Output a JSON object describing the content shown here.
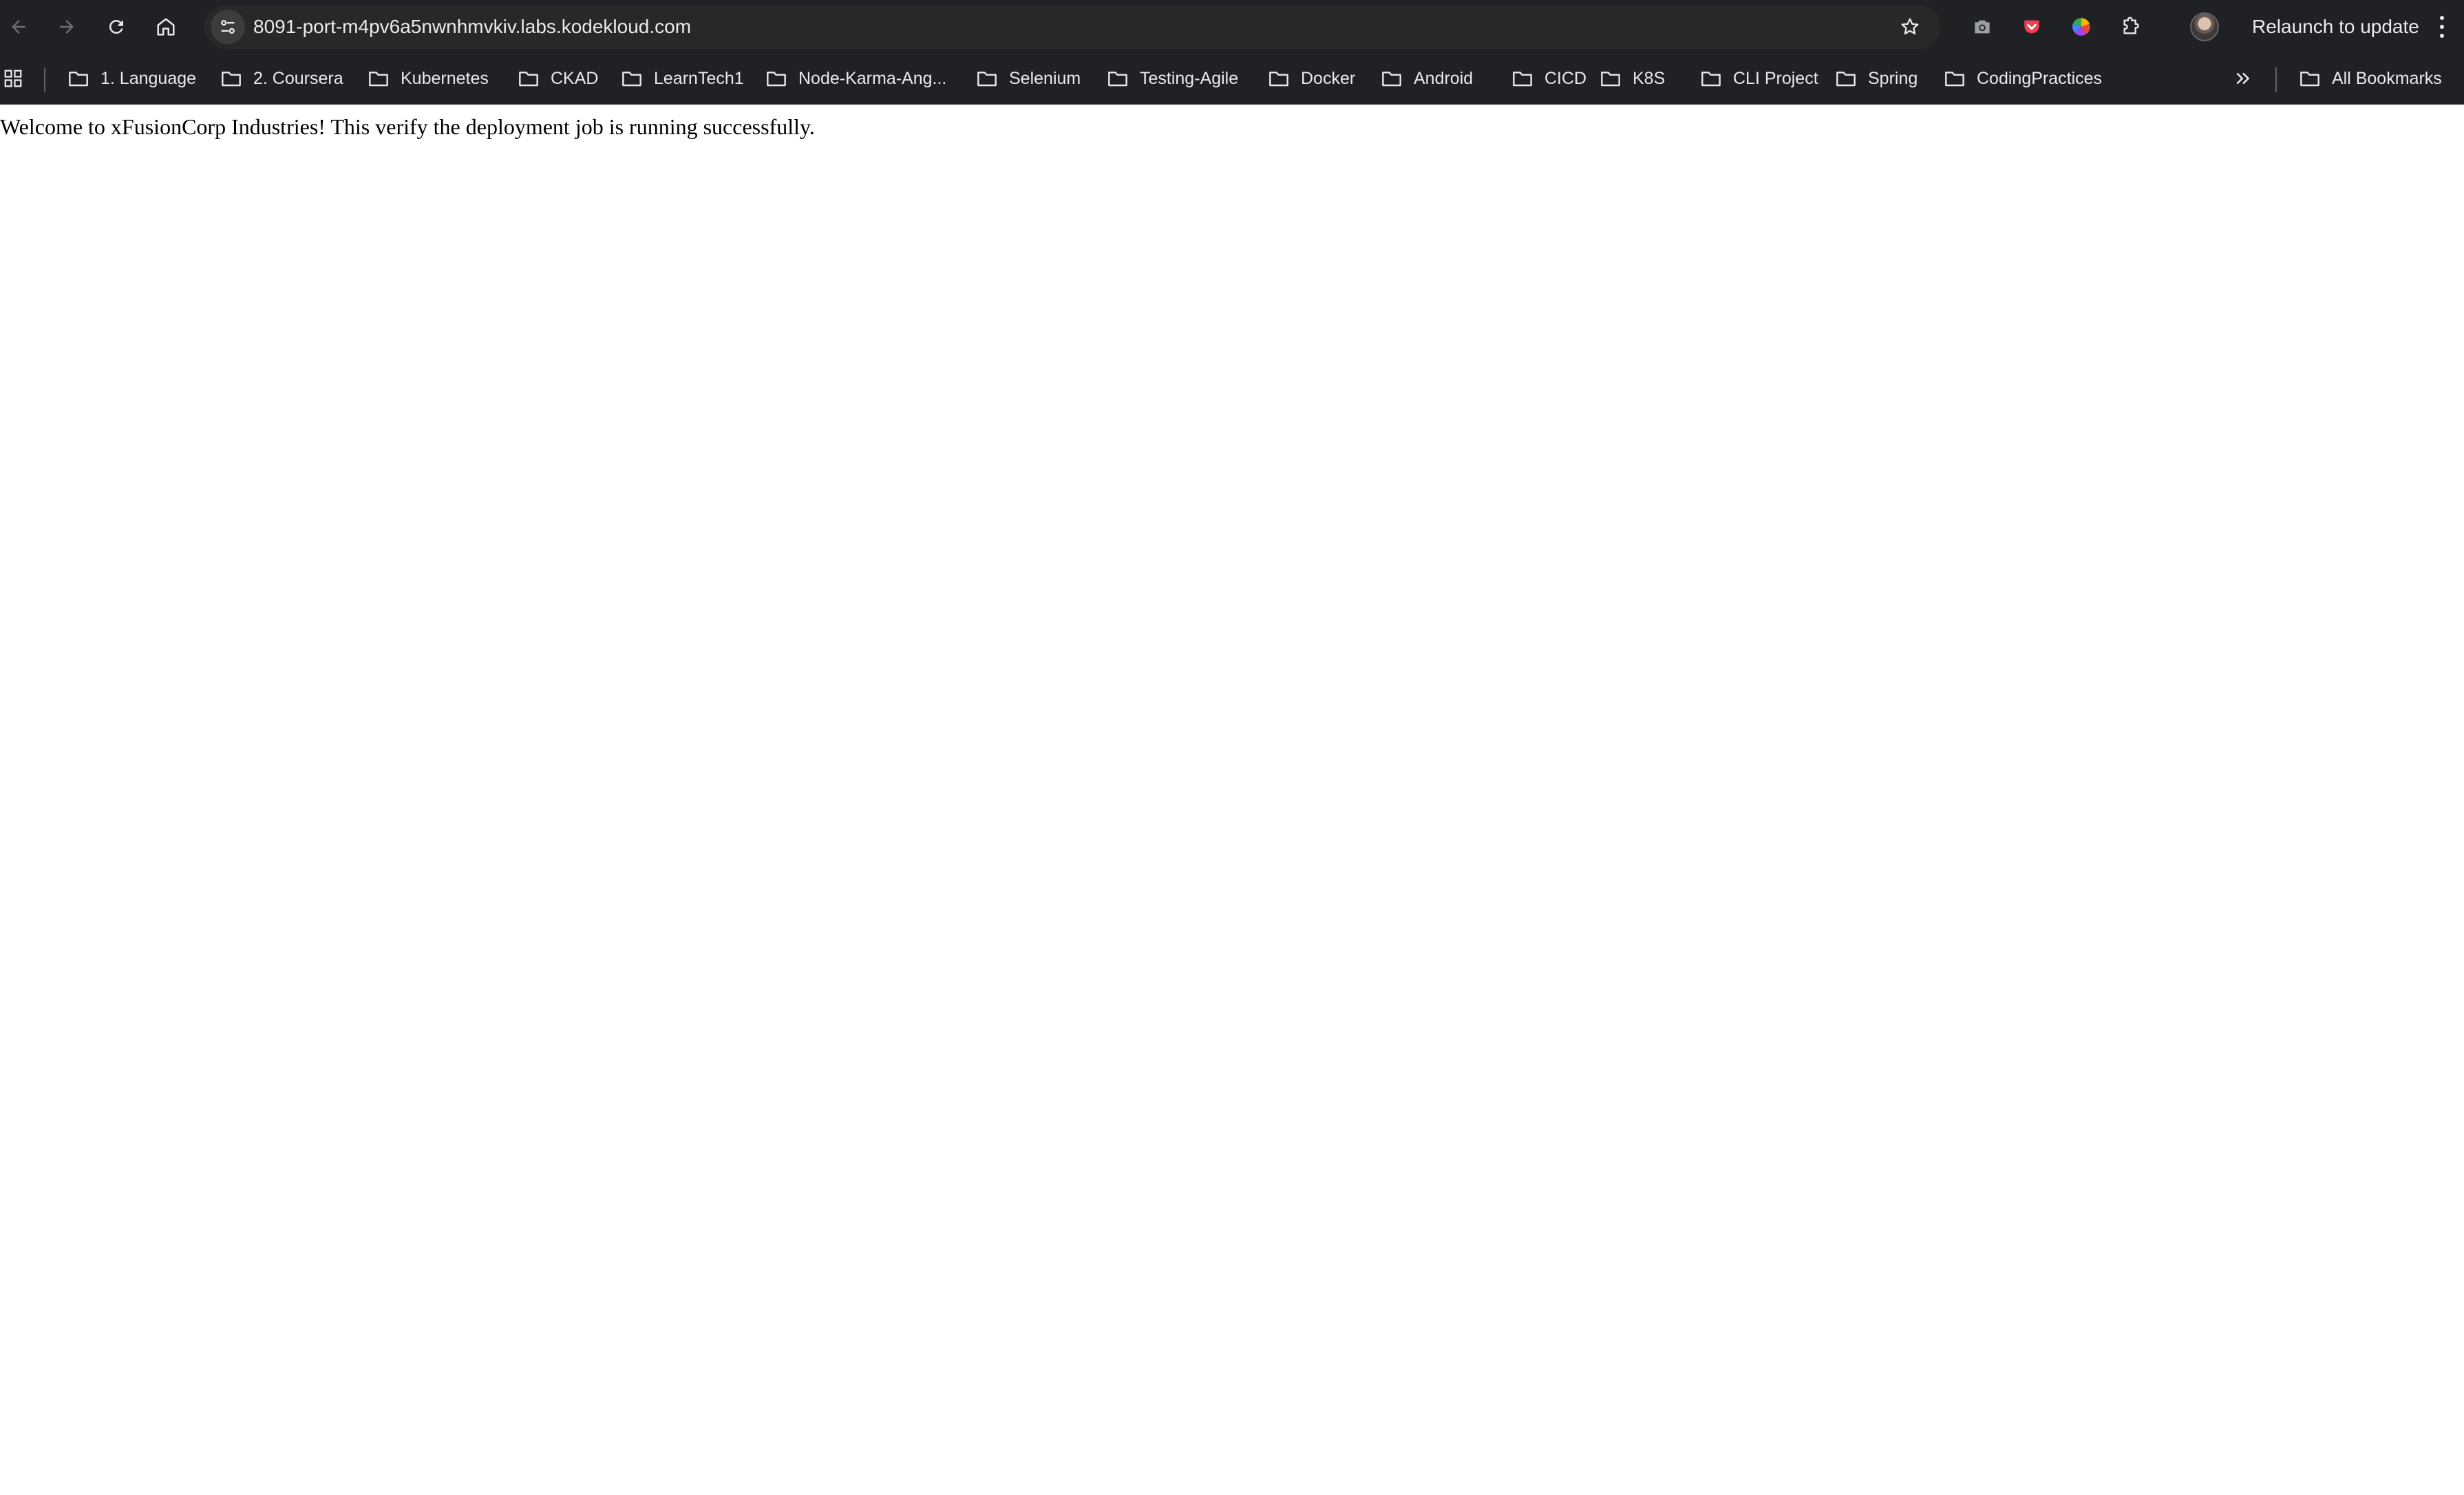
{
  "browser": {
    "url": "8091-port-m4pv6a5nwnhmvkiv.labs.kodekloud.com",
    "relaunch_label": "Relaunch to update",
    "toolbar_icons": [
      "back-icon",
      "forward-icon",
      "reload-icon",
      "home-icon",
      "site-info-icon",
      "bookmark-star-icon",
      "camera-icon",
      "pocket-icon",
      "color-picker-icon",
      "extensions-icon",
      "avatar",
      "menu-icon"
    ]
  },
  "bookmarks": {
    "items": [
      {
        "label": "1. Language"
      },
      {
        "label": "2. Coursera"
      },
      {
        "label": "Kubernetes"
      },
      {
        "label": "CKAD"
      },
      {
        "label": "LearnTech1"
      },
      {
        "label": "Node-Karma-Ang..."
      },
      {
        "label": "Selenium"
      },
      {
        "label": "Testing-Agile"
      },
      {
        "label": "Docker"
      },
      {
        "label": "Android"
      },
      {
        "label": "CICD"
      },
      {
        "label": "K8S"
      },
      {
        "label": "CLI Project"
      },
      {
        "label": "Spring"
      },
      {
        "label": "CodingPractices"
      }
    ],
    "all_bookmarks_label": "All Bookmarks"
  },
  "page": {
    "message": "Welcome to xFusionCorp Industries! This verify the deployment job is running successfully."
  },
  "colors": {
    "toolbar_bg": "#202124",
    "omnibox_bg": "#282828",
    "text_light": "#e8eaed",
    "page_bg": "#ffffff",
    "pocket_red": "#ef4056"
  }
}
